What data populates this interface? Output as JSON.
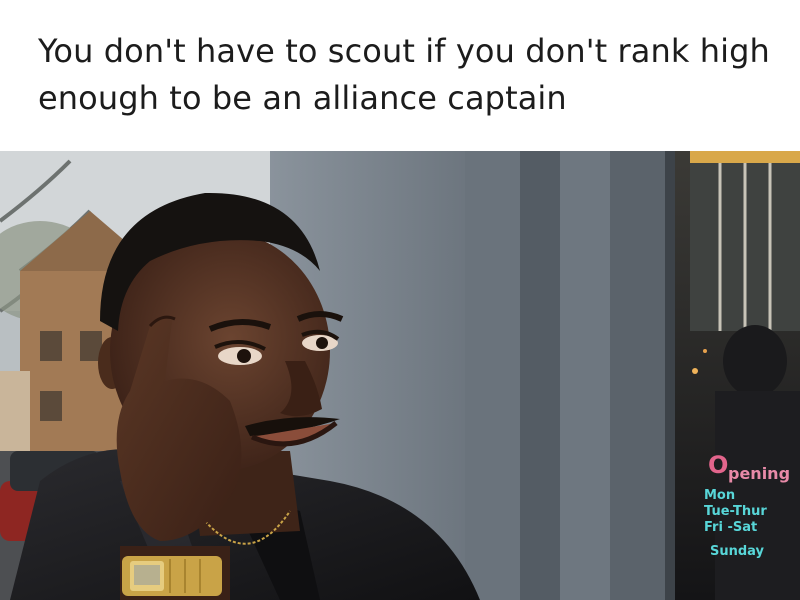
{
  "caption": {
    "text": "You don't have to scout if you don't rank high enough to be an alliance captain"
  },
  "photo": {
    "sign": {
      "title": "Opening",
      "lines": [
        "Mon",
        "Tue-Thur",
        "Fri -Sat",
        "Sunday"
      ]
    },
    "colors": {
      "wall": "#7a838d",
      "pillar": "#5d666f",
      "skin": "#4a2c1c",
      "jacket": "#1b1b1d",
      "watch": "#c9a347",
      "sign_teal": "#58d6d8",
      "sign_pink": "#e2658c"
    }
  }
}
